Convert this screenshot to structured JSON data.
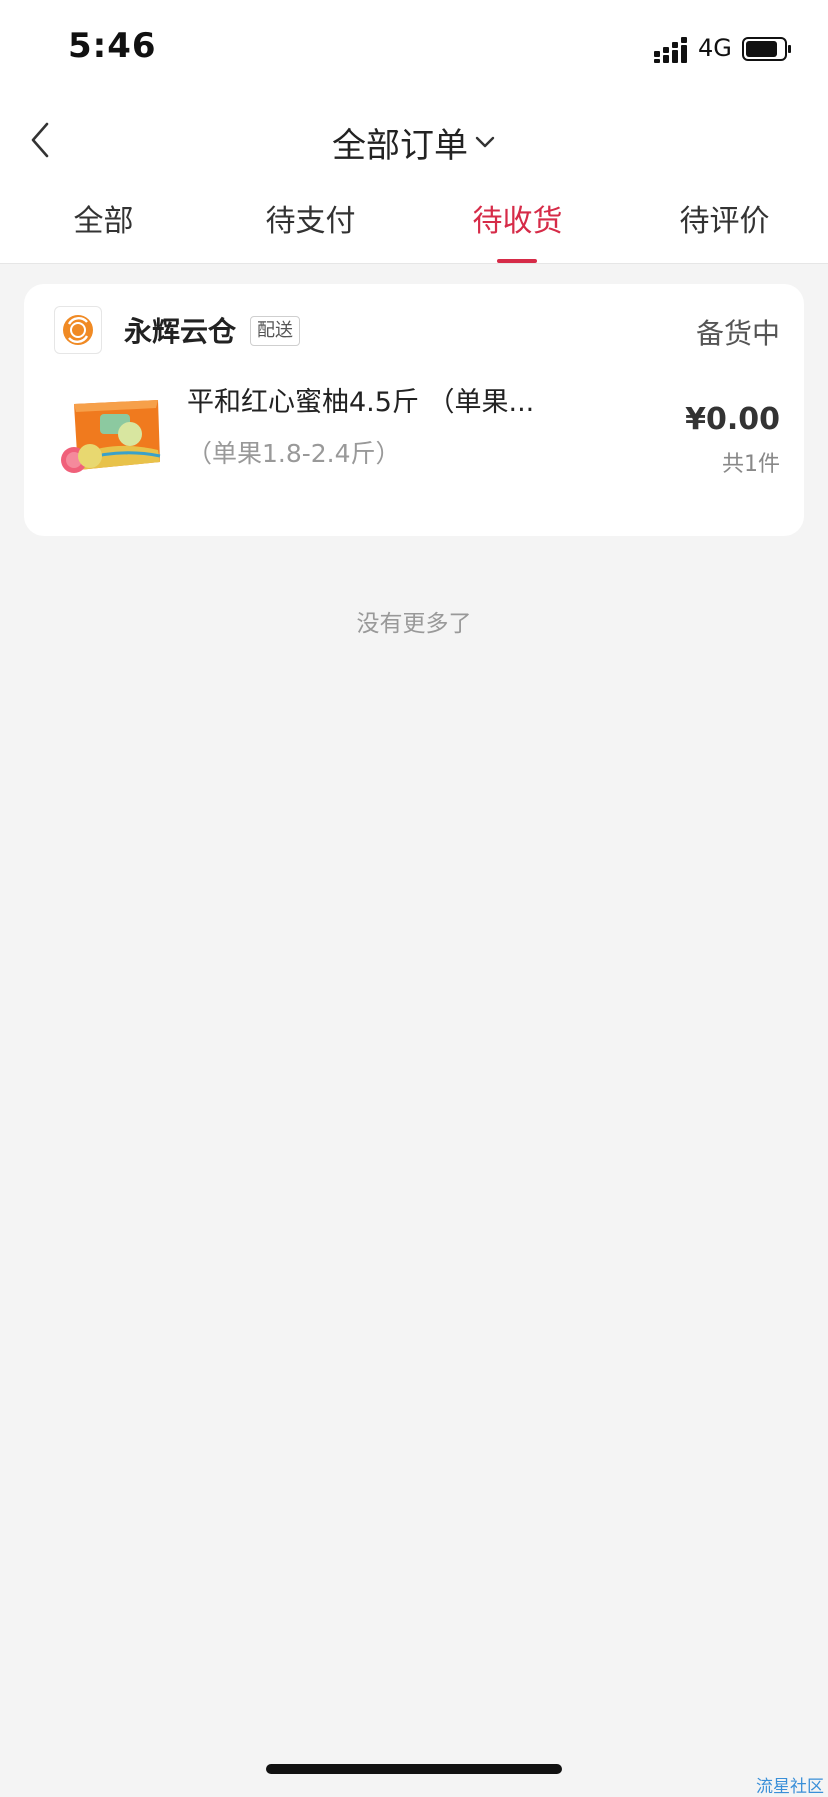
{
  "status_bar": {
    "time": "5:46",
    "network": "4G"
  },
  "nav": {
    "title": "全部订单"
  },
  "tabs": [
    {
      "label": "全部"
    },
    {
      "label": "待支付"
    },
    {
      "label": "待收货",
      "active": true
    },
    {
      "label": "待评价"
    }
  ],
  "order": {
    "store_name": "永辉云仓",
    "delivery_badge": "配送",
    "status": "备货中",
    "product": {
      "name": "平和红心蜜柚4.5斤 （单果...",
      "spec": "（单果1.8-2.4斤）",
      "price": "¥0.00",
      "quantity": "共1件"
    }
  },
  "list_footer": "没有更多了",
  "watermark": "流星社区",
  "colors": {
    "accent": "#d62b48",
    "background": "#f4f4f4",
    "card": "#ffffff",
    "logo_orange": "#f08a24"
  }
}
